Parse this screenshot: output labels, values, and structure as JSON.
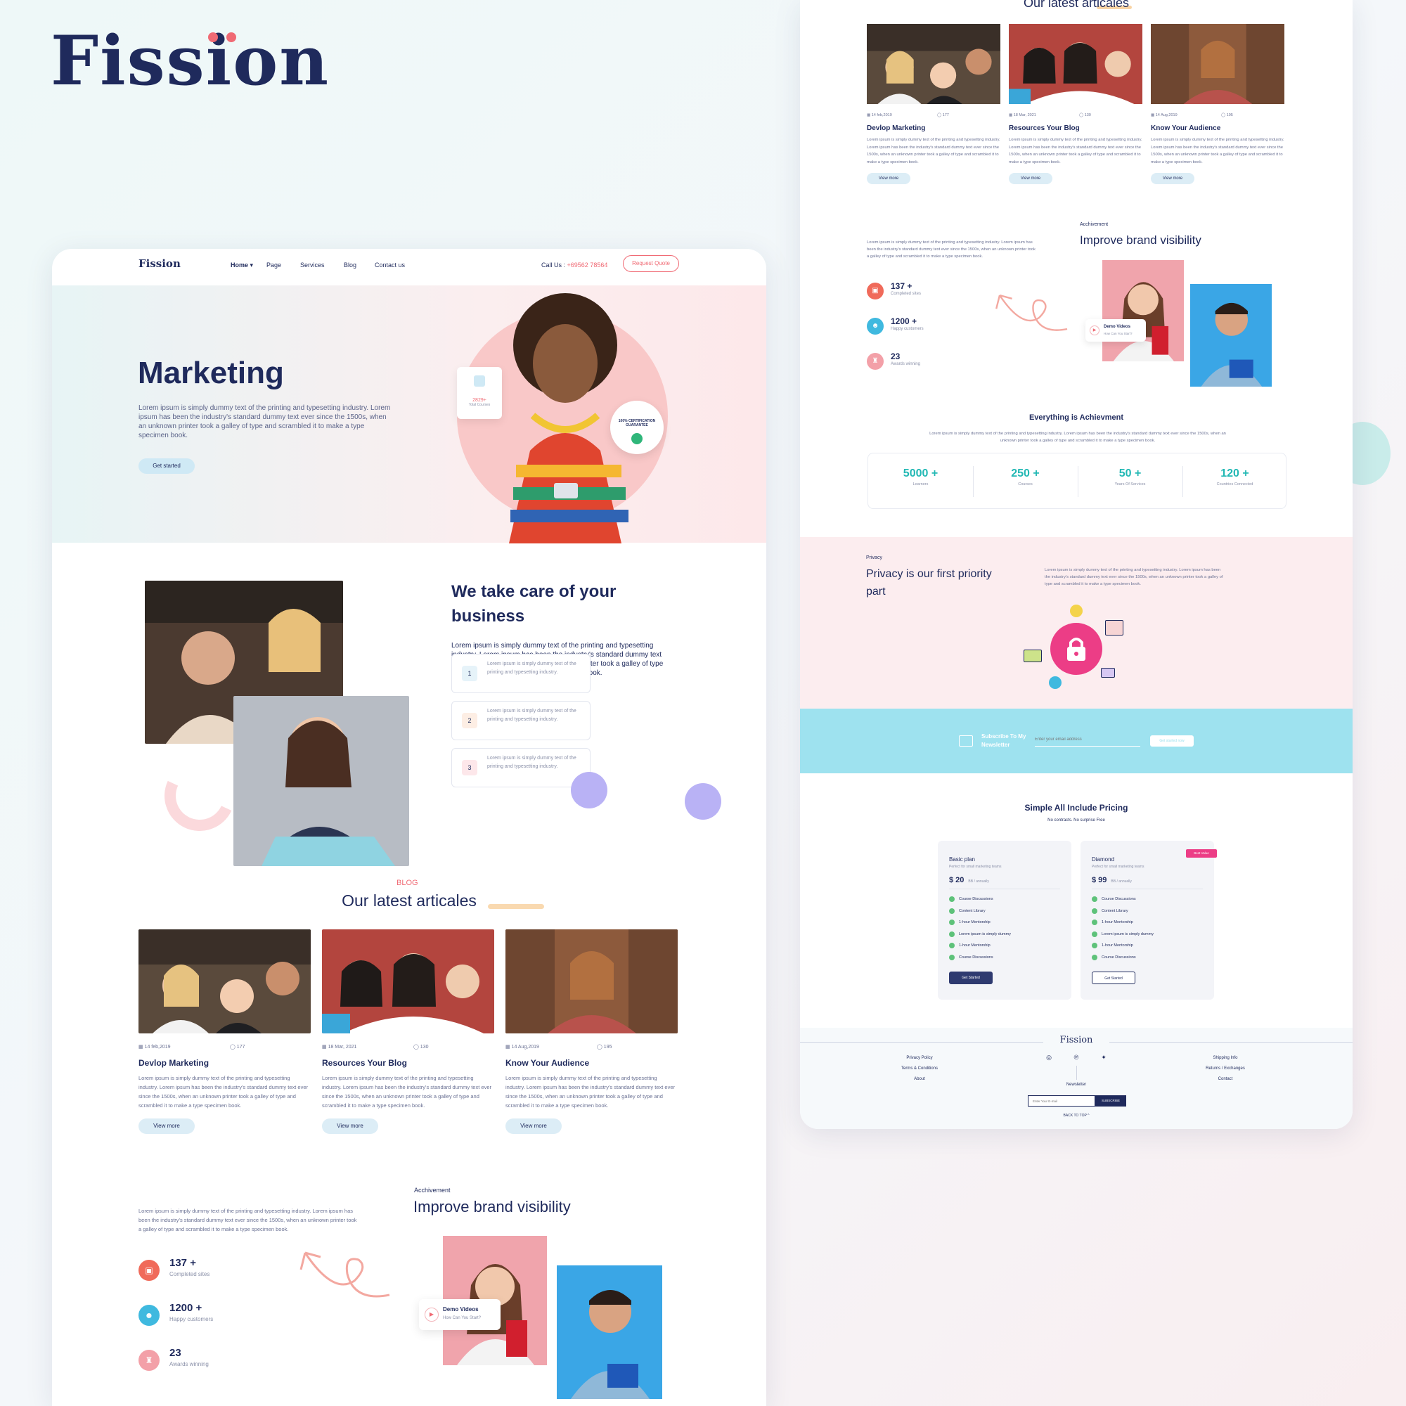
{
  "brand": {
    "name": "Fission"
  },
  "colors": {
    "navy": "#1f2a5c",
    "coral": "#f06a74",
    "teal": "#22b8b4",
    "pink": "#ec3d86",
    "sky": "#9ee2ef",
    "purple": "#b9b2f5"
  },
  "nav": {
    "logo": "Fission",
    "items": [
      "Home",
      "Page",
      "Services",
      "Blog",
      "Contact us"
    ],
    "call_label": "Call Us :",
    "call_number": "+69562 78564",
    "quote_label": "Request Quote"
  },
  "hero": {
    "title": "Marketing",
    "text": "Lorem ipsum is simply dummy text of the printing and typesetting industry. Lorem ipsum has been the industry's standard dummy text ever since the 1500s, when an unknown printer took a galley of type and scrambled it to make a type specimen book.",
    "cta": "Get started",
    "courses_count": "2829+",
    "courses_label": "Total Courses",
    "badge_text": "100% CERTIFICATION GUARANTEE"
  },
  "care": {
    "title": "We take care of your business",
    "text": "Lorem ipsum is simply dummy text of the printing and typesetting industry. Lorem ipsum has been the industry's standard dummy text ever since the 1500s, when an unknown printer took a galley of type and scrambled it to make a type specimen book.",
    "steps": [
      {
        "num": "1",
        "text": "Lorem ipsum is simply dummy text of the printing and typesetting industry."
      },
      {
        "num": "2",
        "text": "Lorem ipsum is simply dummy text of the printing and typesetting industry."
      },
      {
        "num": "3",
        "text": "Lorem ipsum is simply dummy text of the printing and typesetting industry."
      }
    ]
  },
  "blog": {
    "eyebrow": "BLOG",
    "title": "Our latest articales",
    "posts": [
      {
        "date": "14 feb,2019",
        "comments": "177",
        "title": "Devlop Marketing",
        "text": "Lorem ipsum is simply dummy text of the printing and typesetting industry. Lorem ipsum has been the industry's standard dummy text ever since the 1500s, when an unknown printer took a galley of type and scrambled it to make a type specimen book.",
        "more": "View more"
      },
      {
        "date": "18 Mar, 2021",
        "comments": "130",
        "title": "Resources Your Blog",
        "text": "Lorem ipsum is simply dummy text of the printing and typesetting industry. Lorem ipsum has been the industry's standard dummy text ever since the 1500s, when an unknown printer took a galley of type and scrambled it to make a type specimen book.",
        "more": "View more"
      },
      {
        "date": "14 Aug,2019",
        "comments": "195",
        "title": "Know Your Audience",
        "text": "Lorem ipsum is simply dummy text of the printing and typesetting industry. Lorem ipsum has been the industry's standard dummy text ever since the 1500s, when an unknown printer took a galley of type and scrambled it to make a type specimen book.",
        "more": "View more"
      }
    ]
  },
  "achievement": {
    "eyebrow": "Acchivement",
    "title": "Improve brand visibility",
    "text": "Lorem ipsum is simply dummy text of the printing and typesetting industry. Lorem ipsum has been the industry's standard dummy text ever since the 1500s, when an unknown printer took a galley of type and scrambled it to make a type specimen book.",
    "stats": [
      {
        "value": "137 +",
        "label": "Completed sites"
      },
      {
        "value": "1200 +",
        "label": "Happy customers"
      },
      {
        "value": "23",
        "label": "Awards winning"
      }
    ],
    "demo_title": "Demo Videos",
    "demo_sub": "How Can You Start?"
  },
  "everything": {
    "title": "Everything is Achievment",
    "text": "Lorem ipsum is simply dummy text of the printing and typesetting industry. Lorem ipsum has been the industry's standard dummy text ever since the 1500s, when an unknown printer took a galley of type and scrambled it to make a type specimen book.",
    "counters": [
      {
        "value": "5000 +",
        "label": "Learners"
      },
      {
        "value": "250 +",
        "label": "Courses"
      },
      {
        "value": "50 +",
        "label": "Years Of Services"
      },
      {
        "value": "120 +",
        "label": "Countries Connected"
      }
    ]
  },
  "privacy": {
    "eyebrow": "Privacy",
    "title": "Privacy is our first priority part",
    "text": "Lorem ipsum is simply dummy text of the printing and typesetting industry. Lorem ipsum has been the industry's standard dummy text ever since the 1500s, when an unknown printer took a galley of type and scrambled it to make a type specimen book."
  },
  "newsletter": {
    "label": "Subscribe To My Newsletter",
    "placeholder": "Enter your email address",
    "button": "Get started now"
  },
  "pricing": {
    "title": "Simple All Include Pricing",
    "subtitle": "No contracts. No surprise Free",
    "plans": [
      {
        "name": "Basic plan",
        "sub": "Perfect for small marketing teams",
        "price": "$ 20",
        "per": "BB / annually",
        "features": [
          "Course Discussions",
          "Content Library",
          "1-hour Mentorship",
          "Lorem ipsum is simply dummy",
          "1-hour Mentorship",
          "Course Discussions"
        ],
        "cta": "Get Started"
      },
      {
        "name": "Diamond",
        "sub": "Perfect for small marketing teams",
        "price": "$ 99",
        "per": "BB / annually",
        "tag": "Best Value",
        "features": [
          "Course Discussions",
          "Content Library",
          "1-hour Mentorship",
          "Lorem ipsum is simply dummy",
          "1-hour Mentorship",
          "Course Discussions"
        ],
        "cta": "Get Started"
      }
    ]
  },
  "footer": {
    "brand": "Fission",
    "left_links": [
      "Privacy Policy",
      "Terms & Conditions",
      "About"
    ],
    "right_links": [
      "Shipping Info",
      "Returns / Exchanges",
      "Contact"
    ],
    "newsletter_label": "Newsletter",
    "email_placeholder": "Enter Your E-mail",
    "subscribe": "SUBSCRIBE",
    "back_to_top": "BACK TO TOP ^"
  }
}
